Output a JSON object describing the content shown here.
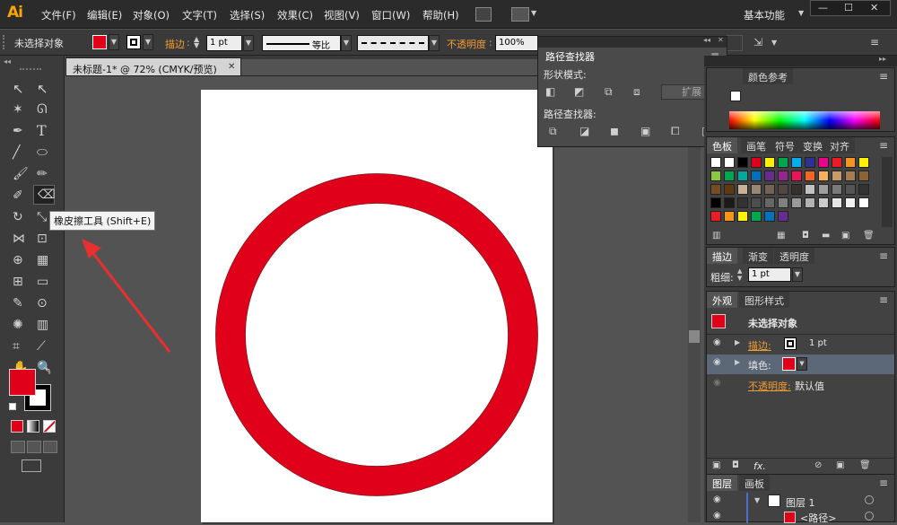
{
  "menubar": {
    "logo": "Ai",
    "items": [
      "文件(F)",
      "编辑(E)",
      "对象(O)",
      "文字(T)",
      "选择(S)",
      "效果(C)",
      "视图(V)",
      "窗口(W)",
      "帮助(H)"
    ],
    "workspace": "基本功能",
    "win_min": "—",
    "win_max": "☐",
    "win_close": "✕"
  },
  "control": {
    "selection_label": "未选择对象",
    "stroke_label": "描边",
    "stroke_value": "1 pt",
    "profile_label": "等比",
    "opacity_label": "不透明度",
    "opacity_value": "100%"
  },
  "document_tab": {
    "title": "未标题-1* @ 72% (CMYK/预览)",
    "close": "✕"
  },
  "tooltip": "橡皮擦工具 (Shift+E)",
  "pathfinder": {
    "tab": "路径查找器",
    "shape_modes_label": "形状模式:",
    "expand_button": "扩展",
    "pathfinders_label": "路径查找器:"
  },
  "color_guide_tab": "颜色参考",
  "swatches_tabs": [
    "色板",
    "画笔",
    "符号",
    "变换",
    "对齐"
  ],
  "stroke_panel": {
    "tabs": [
      "描边",
      "渐变",
      "透明度"
    ],
    "weight_label": "粗细:",
    "weight_value": "1 pt"
  },
  "appearance": {
    "tabs": [
      "外观",
      "图形样式"
    ],
    "title": "未选择对象",
    "stroke_label": "描边:",
    "stroke_value": "1 pt",
    "fill_label": "填色:",
    "opacity_label": "不透明度:",
    "opacity_value": "默认值",
    "fx": "fx."
  },
  "layers": {
    "tabs": [
      "图层",
      "画板"
    ],
    "layer_name": "图层 1",
    "path_name": "<路径>"
  },
  "colors": {
    "accent_red": "#e0001a",
    "artboard": "#ffffff",
    "ui_dark": "#2b2b2b"
  },
  "swatch_colors": [
    [
      "#ffffff",
      "#ffffff",
      "#000000",
      "#e0001a",
      "#fff200",
      "#00a650",
      "#00aeef",
      "#2e3192",
      "#ec008c",
      "#ed1c24",
      "#f7941d",
      "#fff200"
    ],
    [
      "#8dc63f",
      "#00a651",
      "#00a99d",
      "#0072bc",
      "#662d91",
      "#92278f",
      "#ed145b",
      "#f26522",
      "#fbaf5d",
      "#c69c6d",
      "#a67c52",
      "#8c6239"
    ],
    [
      "#754c24",
      "#603913",
      "#c7b299",
      "#998675",
      "#736357",
      "#534741",
      "#37302d",
      "#c2c2c2",
      "#9e9e9e",
      "#7a7a7a",
      "#555555",
      "#333333"
    ],
    [
      "#000000",
      "#1a1a1a",
      "#333333",
      "#4d4d4d",
      "#666666",
      "#808080",
      "#999999",
      "#b3b3b3",
      "#cccccc",
      "#e6e6e6",
      "#f2f2f2",
      "#ffffff"
    ],
    [
      "#ed1c24",
      "#f7941d",
      "#fff200",
      "#00a650",
      "#0072bc",
      "#662d91"
    ]
  ]
}
